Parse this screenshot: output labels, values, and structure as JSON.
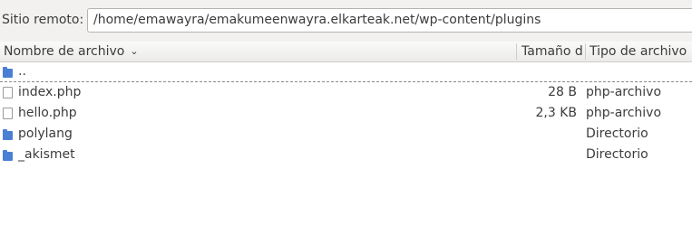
{
  "remote": {
    "label": "Sitio remoto:",
    "path": "/home/emawayra/emakumeenwayra.elkarteak.net/wp-content/plugins"
  },
  "columns": {
    "name": "Nombre de archivo",
    "size": "Tamaño de",
    "type": "Tipo de archivo",
    "sort_icon": "chevron-down-icon"
  },
  "rows": [
    {
      "name": "..",
      "size": "",
      "type": "",
      "icon": "folder-icon"
    },
    {
      "name": "index.php",
      "size": "28 B",
      "type": "php-archivo",
      "icon": "file-icon"
    },
    {
      "name": "hello.php",
      "size": "2,3 KB",
      "type": "php-archivo",
      "icon": "file-icon"
    },
    {
      "name": "polylang",
      "size": "",
      "type": "Directorio",
      "icon": "folder-icon"
    },
    {
      "name": "_akismet",
      "size": "",
      "type": "Directorio",
      "icon": "folder-icon"
    }
  ],
  "colors": {
    "folder": "#4a7fd4",
    "header_bg": "#f2f1f0"
  }
}
